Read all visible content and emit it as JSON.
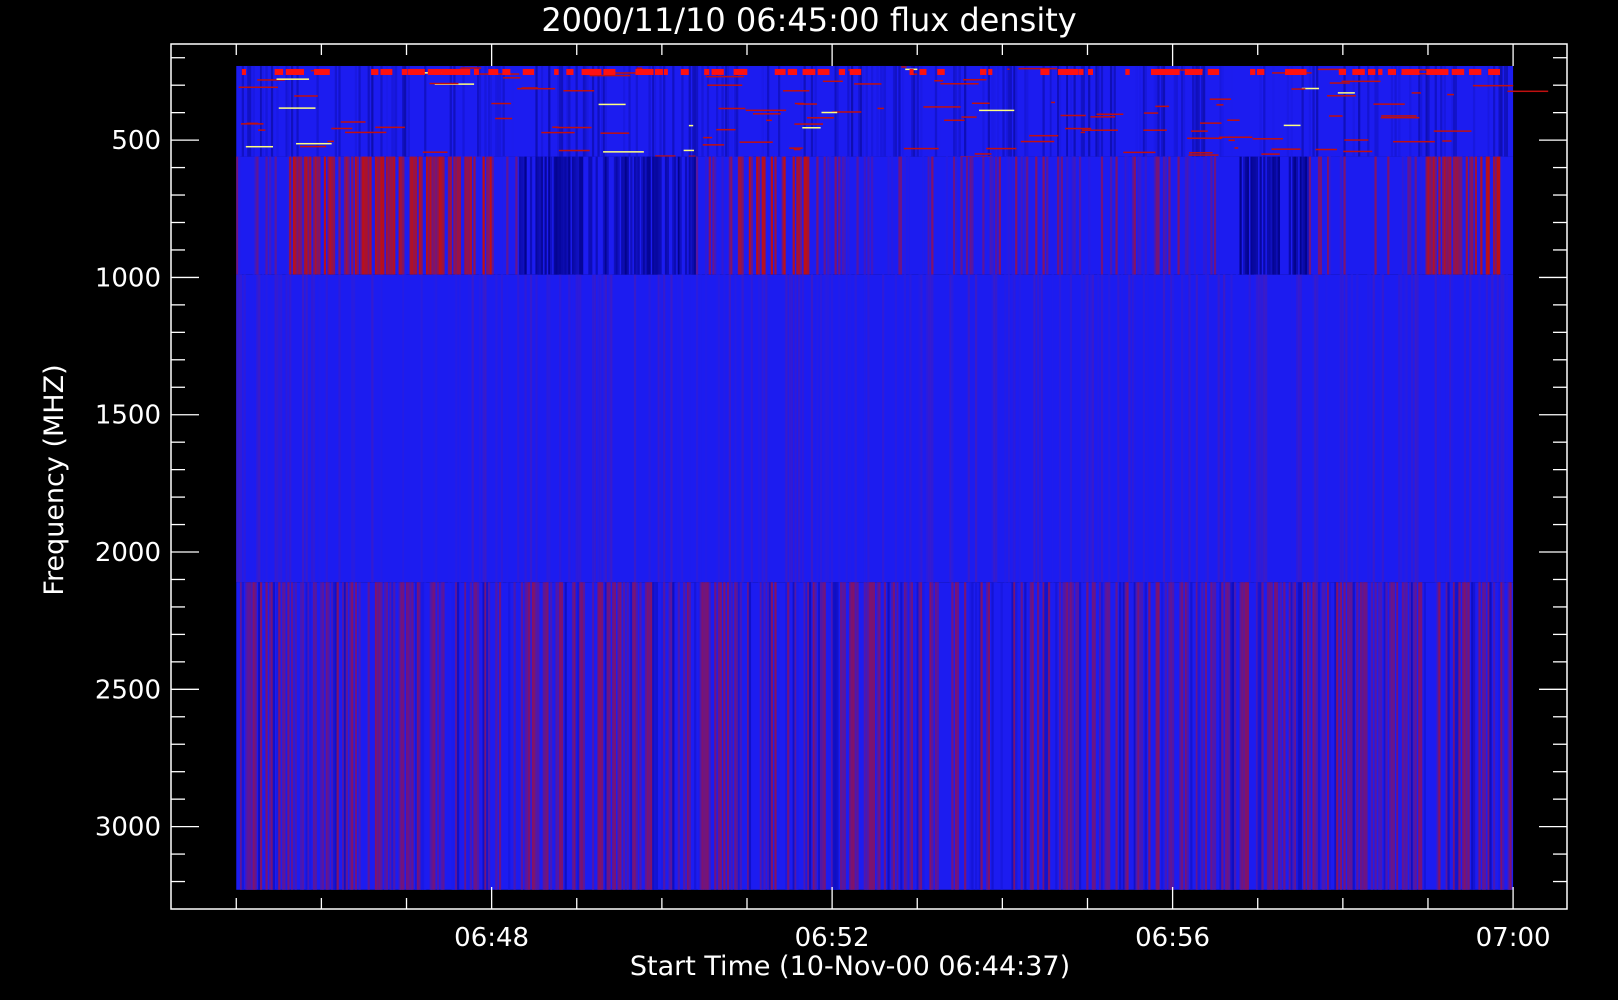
{
  "chart_data": {
    "type": "heatmap",
    "title": "2000/11/10 06:45:00 flux density",
    "xlabel": "Start Time (10-Nov-00 06:44:37)",
    "ylabel": "Frequency (MHZ)",
    "x_start": "06:45:00",
    "x_end": "07:00:00",
    "xlim": [
      "06:44:14",
      "07:00:38"
    ],
    "ylim": [
      3300,
      150
    ],
    "y_reversed": true,
    "x_tick_labels": [
      "06:48",
      "06:52",
      "06:56",
      "07:00"
    ],
    "x_ticks": [
      "06:48",
      "06:52",
      "06:56",
      "07:00"
    ],
    "y_tick_labels": [
      "500",
      "1000",
      "1500",
      "2000",
      "2500",
      "3000"
    ],
    "y_ticks": [
      500,
      1000,
      1500,
      2000,
      2500,
      3000
    ],
    "grid": false,
    "colorscale": "blue-to-red (low to high)",
    "bands": [
      {
        "range_mhz": [
          230,
          560
        ],
        "appearance": "blue with scattered red and white speckles, intermittent red dots at top edge"
      },
      {
        "range_mhz": [
          560,
          990
        ],
        "appearance": "blue with strong red vertical striations (clustered near 06:46-06:48, 06:51, 06:59)"
      },
      {
        "range_mhz": [
          990,
          2110
        ],
        "appearance": "mostly uniform blue with faint vertical striations"
      },
      {
        "range_mhz": [
          2110,
          3230
        ],
        "appearance": "blue with red-purple vertical striations"
      }
    ],
    "colors": {
      "background": "#000000",
      "axes": "#ffffff",
      "low": "#1a1aff",
      "high": "#c01010"
    }
  }
}
